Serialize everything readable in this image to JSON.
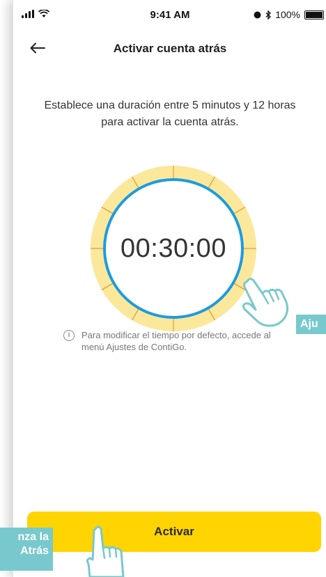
{
  "status_bar": {
    "time": "9:41 AM",
    "battery": "100%",
    "icons": [
      "signal-icon",
      "wifi-icon",
      "alarm-icon",
      "bluetooth-icon",
      "battery-icon"
    ]
  },
  "header": {
    "title": "Activar cuenta atrás",
    "back_icon": "arrow-left-icon"
  },
  "description": "Establece una duración entre 5 minutos y 12 horas para activar la cuenta atrás.",
  "timer": {
    "value": "00:30:00"
  },
  "info": {
    "icon": "info-icon",
    "text": "Para modificar el tiempo por defecto, accede al menú Ajustes de ContiGo."
  },
  "primary_button": {
    "label": "Activar"
  },
  "callouts": {
    "right": "Aju",
    "left_line1": "nza la",
    "left_line2": "Atrás"
  },
  "colors": {
    "accent_yellow": "#ffd400",
    "ring_yellow": "#fbe89a",
    "ring_blue": "#1b9be3",
    "callout_teal": "#78c9cd",
    "tick_orange": "#e0a040"
  }
}
